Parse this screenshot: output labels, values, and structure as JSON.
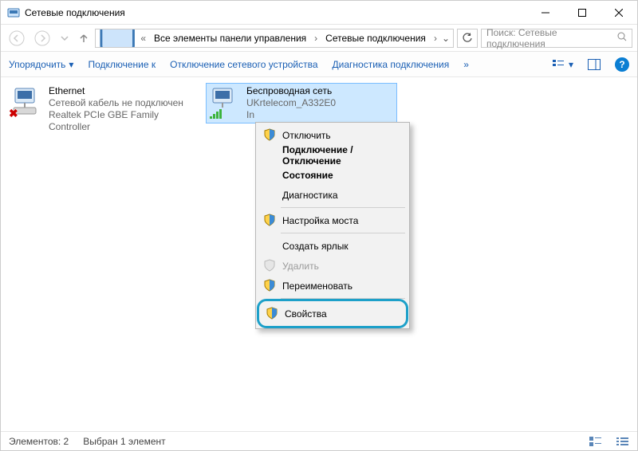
{
  "window": {
    "title": "Сетевые подключения"
  },
  "address": {
    "crumb1": "Все элементы панели управления",
    "crumb2": "Сетевые подключения"
  },
  "search": {
    "placeholder": "Поиск: Сетевые подключения"
  },
  "commands": {
    "organize": "Упорядочить",
    "connectTo": "Подключение к",
    "disableDevice": "Отключение сетевого устройства",
    "diagnose": "Диагностика подключения"
  },
  "items": {
    "ethernet": {
      "name": "Ethernet",
      "status": "Сетевой кабель не подключен",
      "device": "Realtek PCIe GBE Family Controller"
    },
    "wifi": {
      "name": "Беспроводная сеть",
      "status": "UKrtelecom_A332E0",
      "device": "In"
    }
  },
  "context": {
    "disable": "Отключить",
    "connect": "Подключение / Отключение",
    "status": "Состояние",
    "diag": "Диагностика",
    "bridge": "Настройка моста",
    "shortcut": "Создать ярлык",
    "delete": "Удалить",
    "rename": "Переименовать",
    "properties": "Свойства"
  },
  "statusbar": {
    "count": "Элементов: 2",
    "selected": "Выбран 1 элемент"
  }
}
